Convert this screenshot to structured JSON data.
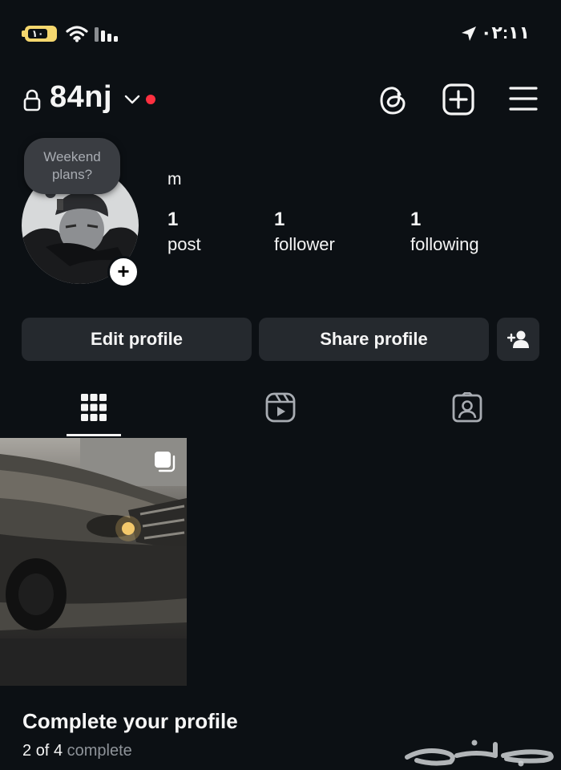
{
  "status_bar": {
    "battery_level": "١٠",
    "time": "٠٢:١١",
    "colors": {
      "battery": "#f5d76e"
    }
  },
  "header": {
    "username": "84nj",
    "icons": [
      "lock-icon",
      "chevron-down-icon",
      "threads-icon",
      "create-post-icon",
      "menu-icon"
    ]
  },
  "profile": {
    "note": "Weekend plans?",
    "display_name": "m",
    "stats": [
      {
        "value": "1",
        "label": "post"
      },
      {
        "value": "1",
        "label": "follower"
      },
      {
        "value": "1",
        "label": "following"
      }
    ]
  },
  "actions": {
    "edit_label": "Edit profile",
    "share_label": "Share profile"
  },
  "tabs": [
    "grid-icon",
    "reels-icon",
    "tagged-icon"
  ],
  "completion": {
    "title": "Complete your profile",
    "done": "2",
    "of_text": "of",
    "total": "4",
    "suffix": "complete"
  },
  "watermark": "حراج",
  "colors": {
    "background": "#0c1014",
    "button": "#25292e",
    "notification_dot": "#ff3040"
  }
}
